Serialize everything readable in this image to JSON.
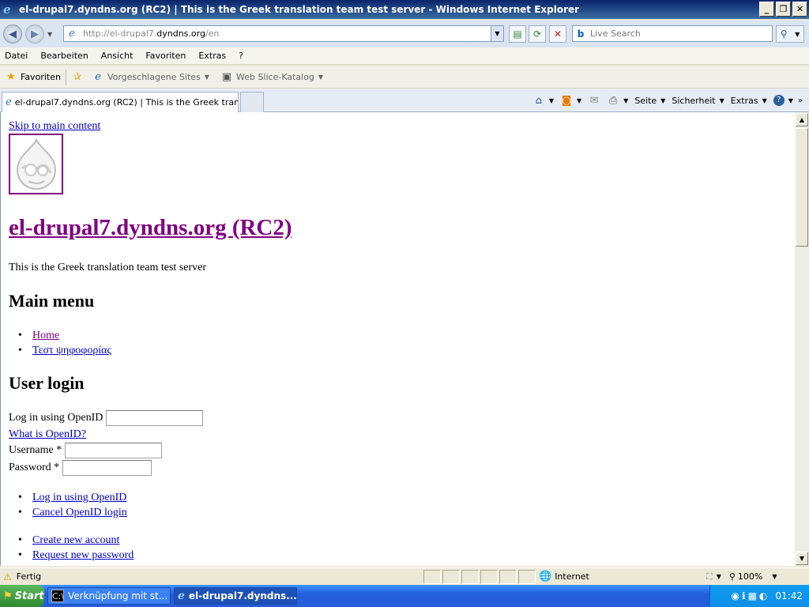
{
  "window": {
    "title": "el-drupal7.dyndns.org (RC2) | This is the Greek translation team test server - Windows Internet Explorer",
    "minimize": "_",
    "maximize": "❐",
    "close": "✕"
  },
  "address": {
    "url_prefix": "http://el-drupal7.",
    "url_domain": "dyndns.org",
    "url_suffix": "/en",
    "search_placeholder": "Live Search"
  },
  "menu": [
    "Datei",
    "Bearbeiten",
    "Ansicht",
    "Favoriten",
    "Extras",
    "?"
  ],
  "favorites_bar": {
    "favorites": "Favoriten",
    "suggested": "Vorgeschlagene Sites",
    "webslice": "Web Slice-Katalog"
  },
  "tab": {
    "title": "el-drupal7.dyndns.org (RC2) | This is the Greek transl..."
  },
  "command_bar": {
    "page": "Seite",
    "safety": "Sicherheit",
    "tools": "Extras"
  },
  "page": {
    "skip_link": "Skip to main content",
    "site_name": "el-drupal7.dyndns.org (RC2)",
    "slogan": "This is the Greek translation team test server",
    "main_menu_heading": "Main menu",
    "main_menu": [
      {
        "label": "Home",
        "visited": true
      },
      {
        "label": "Τεστ ψηφοφορίας",
        "visited": false
      }
    ],
    "user_login_heading": "User login",
    "openid_label": "Log in using OpenID",
    "what_is_openid": "What is OpenID?",
    "username_label": "Username *",
    "password_label": "Password *",
    "openid_links": [
      "Log in using OpenID",
      "Cancel OpenID login"
    ],
    "account_links": [
      "Create new account",
      "Request new password"
    ]
  },
  "status": {
    "text": "Fertig",
    "zone": "Internet",
    "zoom": "100%"
  },
  "taskbar": {
    "start": "Start",
    "items": [
      {
        "label": "Verknüpfung mit st...",
        "active": false
      },
      {
        "label": "el-drupal7.dyndns....",
        "active": true
      }
    ],
    "clock": "01:42"
  }
}
